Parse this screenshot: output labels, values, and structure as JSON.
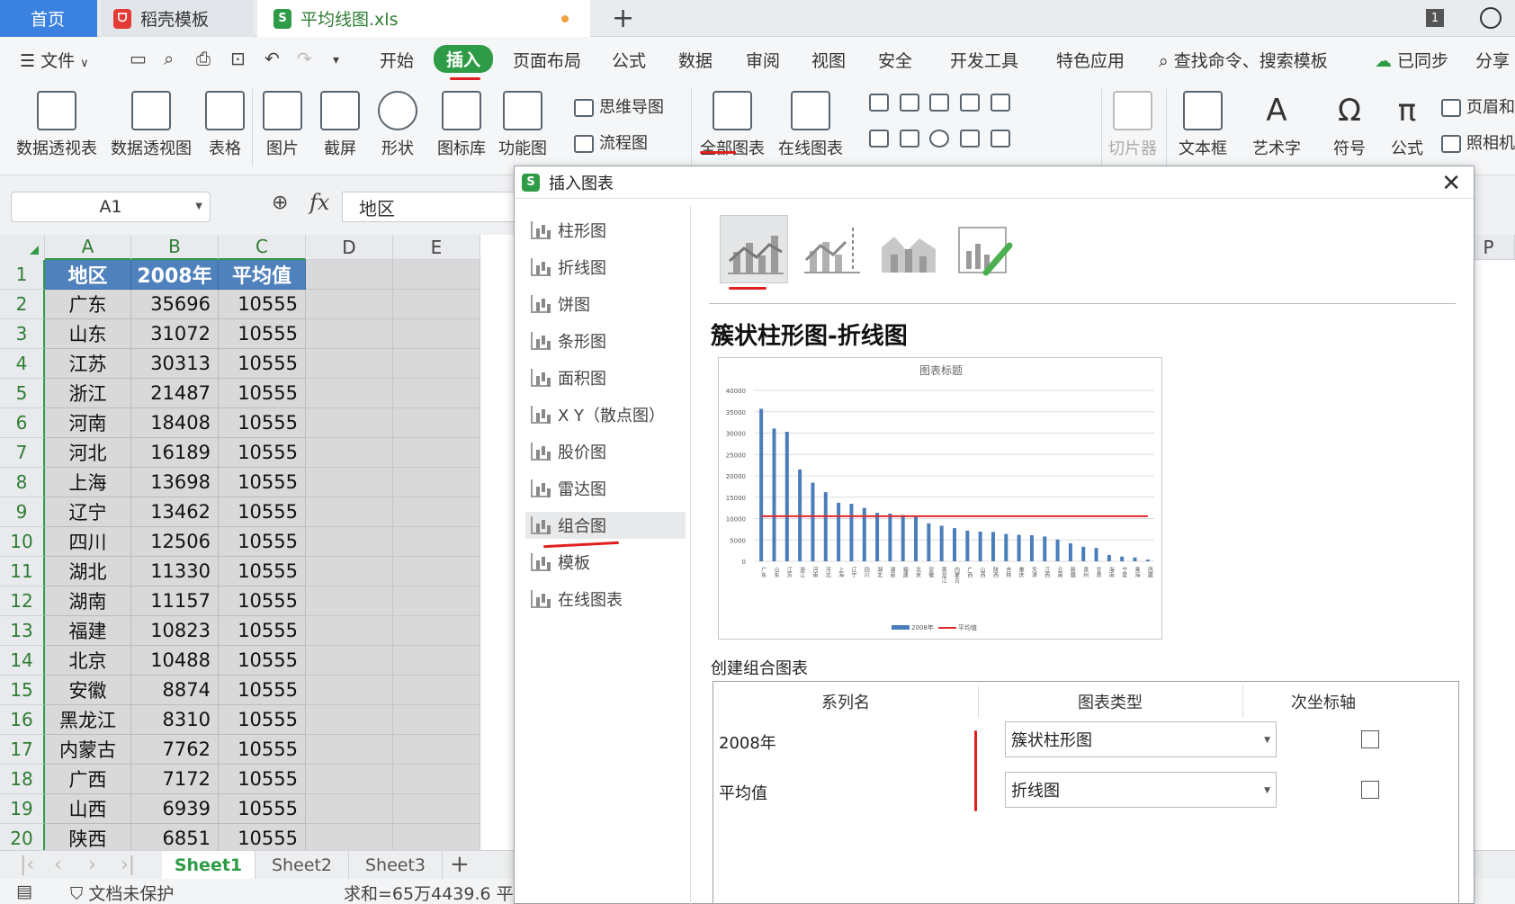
{
  "tabs": {
    "home": "首页",
    "template": "稻壳模板",
    "file": "平均线图.xls",
    "count": "1"
  },
  "menu": {
    "file": "文件",
    "items": [
      "开始",
      "插入",
      "页面布局",
      "公式",
      "数据",
      "审阅",
      "视图",
      "安全",
      "开发工具",
      "特色应用"
    ],
    "active": "插入",
    "search": "查找命令、搜索模板",
    "sync": "已同步",
    "share": "分享"
  },
  "ribbon": {
    "pivot_table": "数据透视表",
    "pivot_chart": "数据透视图",
    "table": "表格",
    "picture": "图片",
    "screenshot": "截屏",
    "shape": "形状",
    "icon_lib": "图标库",
    "func_chart": "功能图",
    "mindmap": "思维导图",
    "flowchart": "流程图",
    "all_charts": "全部图表",
    "online_charts": "在线图表",
    "slicer": "切片器",
    "textbox": "文本框",
    "wordart": "艺术字",
    "symbol": "符号",
    "formula": "公式",
    "header_footer": "页眉和",
    "camera": "照相机"
  },
  "formula_bar": {
    "cell_ref": "A1",
    "fx": "fx",
    "value": "地区"
  },
  "sheet": {
    "columns": [
      "A",
      "B",
      "C",
      "D",
      "E"
    ],
    "col_p": "P",
    "header": [
      "地区",
      "2008年",
      "平均值"
    ],
    "rows": [
      [
        "广东",
        "35696",
        "10555"
      ],
      [
        "山东",
        "31072",
        "10555"
      ],
      [
        "江苏",
        "30313",
        "10555"
      ],
      [
        "浙江",
        "21487",
        "10555"
      ],
      [
        "河南",
        "18408",
        "10555"
      ],
      [
        "河北",
        "16189",
        "10555"
      ],
      [
        "上海",
        "13698",
        "10555"
      ],
      [
        "辽宁",
        "13462",
        "10555"
      ],
      [
        "四川",
        "12506",
        "10555"
      ],
      [
        "湖北",
        "11330",
        "10555"
      ],
      [
        "湖南",
        "11157",
        "10555"
      ],
      [
        "福建",
        "10823",
        "10555"
      ],
      [
        "北京",
        "10488",
        "10555"
      ],
      [
        "安徽",
        "8874",
        "10555"
      ],
      [
        "黑龙江",
        "8310",
        "10555"
      ],
      [
        "内蒙古",
        "7762",
        "10555"
      ],
      [
        "广西",
        "7172",
        "10555"
      ],
      [
        "山西",
        "6939",
        "10555"
      ],
      [
        "陕西",
        "6851",
        "10555"
      ]
    ],
    "row_numbers": [
      "1",
      "2",
      "3",
      "4",
      "5",
      "6",
      "7",
      "8",
      "9",
      "10",
      "11",
      "12",
      "13",
      "14",
      "15",
      "16",
      "17",
      "18",
      "19",
      "20"
    ],
    "sheet_tabs": [
      "Sheet1",
      "Sheet2",
      "Sheet3"
    ],
    "status_protect": "文档未保护",
    "status_sum": "求和=65万4439.6  平均"
  },
  "dialog": {
    "title": "插入图表",
    "chart_types": [
      "柱形图",
      "折线图",
      "饼图",
      "条形图",
      "面积图",
      "X Y（散点图）",
      "股价图",
      "雷达图",
      "组合图",
      "模板",
      "在线图表"
    ],
    "selected_type": "组合图",
    "combo_title": "簇状柱形图-折线图",
    "create_label": "创建组合图表",
    "table_headers": [
      "系列名",
      "图表类型",
      "次坐标轴"
    ],
    "series": [
      {
        "name": "2008年",
        "chart_type": "簇状柱形图",
        "secondary": false
      },
      {
        "name": "平均值",
        "chart_type": "折线图",
        "secondary": false
      }
    ]
  },
  "chart_data": {
    "type": "bar",
    "title": "图表标题",
    "categories": [
      "广东",
      "山东",
      "江苏",
      "浙江",
      "河南",
      "河北",
      "上海",
      "辽宁",
      "四川",
      "湖北",
      "湖南",
      "福建",
      "北京",
      "安徽",
      "黑龙江",
      "内蒙古",
      "广西",
      "山西",
      "陕西",
      "吉林",
      "重庆",
      "天津",
      "江西",
      "云南",
      "新疆",
      "贵州",
      "甘肃",
      "海南",
      "宁夏",
      "青海",
      "西藏"
    ],
    "series": [
      {
        "name": "2008年",
        "chart": "bar",
        "color": "#4a7ebb",
        "values": [
          35696,
          31072,
          30313,
          21487,
          18408,
          16189,
          13698,
          13462,
          12506,
          11330,
          11157,
          10823,
          10488,
          8874,
          8310,
          7762,
          7172,
          6939,
          6851,
          6400,
          6200,
          6100,
          5800,
          5100,
          4200,
          3400,
          3100,
          1500,
          1100,
          900,
          400
        ]
      },
      {
        "name": "平均值",
        "chart": "line",
        "color": "#e02a2a",
        "values": [
          10555,
          10555,
          10555,
          10555,
          10555,
          10555,
          10555,
          10555,
          10555,
          10555,
          10555,
          10555,
          10555,
          10555,
          10555,
          10555,
          10555,
          10555,
          10555,
          10555,
          10555,
          10555,
          10555,
          10555,
          10555,
          10555,
          10555,
          10555,
          10555,
          10555,
          10555
        ]
      }
    ],
    "ylim": [
      0,
      40000
    ],
    "yticks": [
      0,
      5000,
      10000,
      15000,
      20000,
      25000,
      30000,
      35000,
      40000
    ],
    "grid": true,
    "legend": "bottom"
  }
}
